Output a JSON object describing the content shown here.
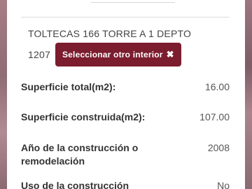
{
  "address": {
    "line1": "TOLTECAS 166 TORRE A 1 DEPTO",
    "line2": "1207"
  },
  "select_button": {
    "label": "Seleccionar otro interior",
    "icon": "close-icon",
    "color": "#7b1d2e"
  },
  "details": [
    {
      "label": "Superficie total(m2):",
      "value": "16.00"
    },
    {
      "label": "Superficie construida(m2):",
      "value": "107.00"
    },
    {
      "label": "Año de la construcción o remodelación",
      "value": "2008"
    },
    {
      "label": "Uso de la construcción",
      "value": "No"
    }
  ]
}
